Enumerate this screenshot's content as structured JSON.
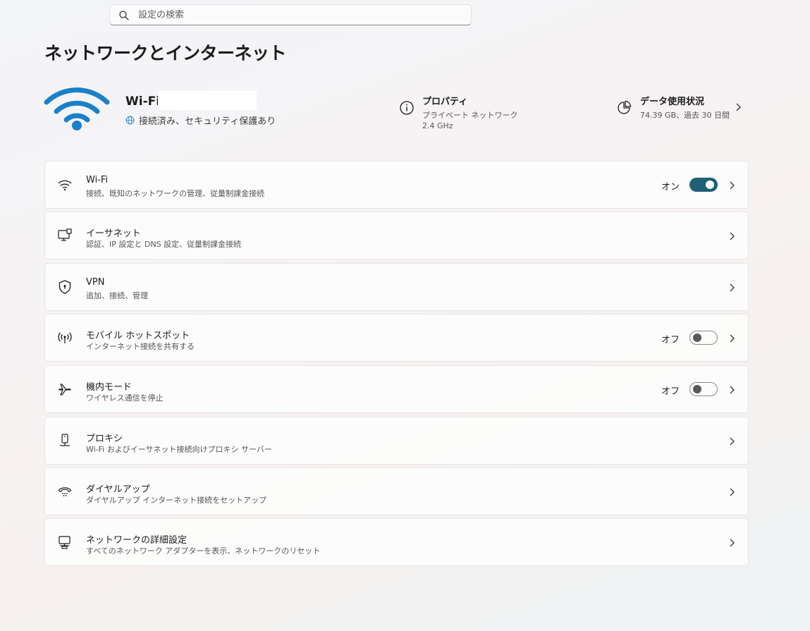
{
  "search": {
    "placeholder": "設定の検索"
  },
  "page": {
    "title": "ネットワークとインターネット"
  },
  "connection": {
    "name": "Wi-Fi",
    "status": "接続済み、セキュリティ保護あり"
  },
  "properties": {
    "title": "プロパティ",
    "line1": "プライベート ネットワーク",
    "line2": "2.4 GHz"
  },
  "data_usage": {
    "title": "データ使用状況",
    "sub": "74.39 GB、過去 30 日間"
  },
  "settings": [
    {
      "icon": "wifi-icon",
      "title": "Wi-Fi",
      "sub": "接続、既知のネットワークの管理、従量制課金接続",
      "toggle_label": "オン",
      "toggle_on": true
    },
    {
      "icon": "ethernet-icon",
      "title": "イーサネット",
      "sub": "認証、IP 設定と DNS 設定、従量制課金接続"
    },
    {
      "icon": "vpn-shield-icon",
      "title": "VPN",
      "sub": "追加、接続、管理"
    },
    {
      "icon": "hotspot-icon",
      "title": "モバイル ホットスポット",
      "sub": "インターネット接続を共有する",
      "toggle_label": "オフ",
      "toggle_on": false
    },
    {
      "icon": "airplane-icon",
      "title": "機内モード",
      "sub": "ワイヤレス通信を停止",
      "toggle_label": "オフ",
      "toggle_on": false
    },
    {
      "icon": "proxy-icon",
      "title": "プロキシ",
      "sub": "Wi-Fi およびイーサネット接続向けプロキシ サーバー"
    },
    {
      "icon": "dialup-icon",
      "title": "ダイヤルアップ",
      "sub": "ダイヤルアップ インターネット接続をセットアップ"
    },
    {
      "icon": "network-monitor-icon",
      "title": "ネットワークの詳細設定",
      "sub": "すべてのネットワーク アダプターを表示、ネットワークのリセット"
    }
  ],
  "colors": {
    "accent": "#1f5f78",
    "wifi_icon": "#1a80c8"
  }
}
